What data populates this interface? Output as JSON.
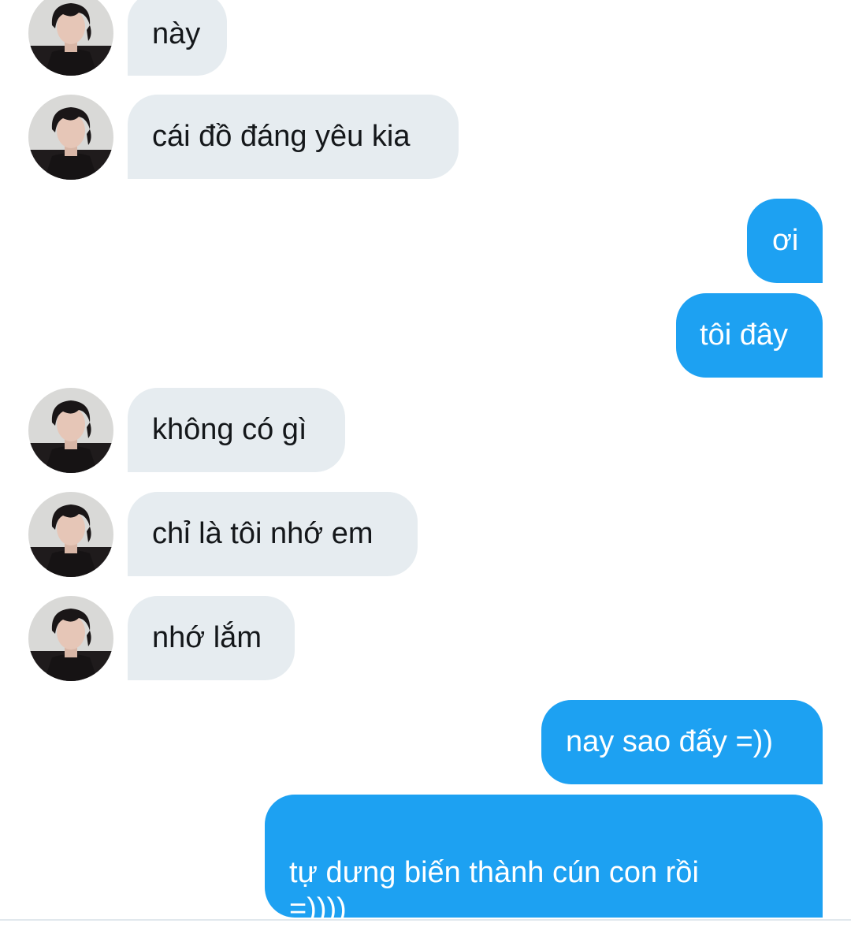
{
  "conversation": {
    "messages": [
      {
        "sender": "contact",
        "text": "này"
      },
      {
        "sender": "contact",
        "text": "cái đồ đáng yêu kia"
      },
      {
        "sender": "me",
        "text": "ơi"
      },
      {
        "sender": "me",
        "text": "tôi đây"
      },
      {
        "sender": "contact",
        "text": "không có gì"
      },
      {
        "sender": "contact",
        "text": "chỉ là tôi nhớ em"
      },
      {
        "sender": "contact",
        "text": "nhớ lắm"
      },
      {
        "sender": "me",
        "text": "nay sao đấy =))"
      },
      {
        "sender": "me",
        "text": "tự dưng biến thành cún con rồi\n=))))"
      }
    ]
  },
  "colors": {
    "incoming_bubble": "#e6ecf0",
    "outgoing_bubble": "#1da1f2",
    "incoming_text": "#14171a",
    "outgoing_text": "#ffffff"
  },
  "icons": {
    "contact_avatar": "avatar"
  }
}
